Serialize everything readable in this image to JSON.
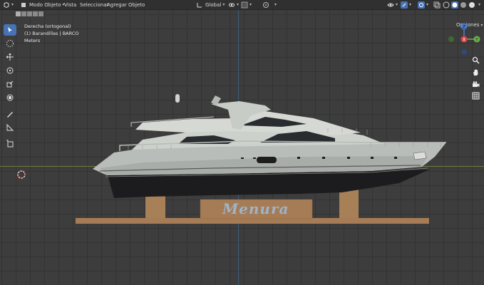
{
  "header": {
    "mode_label": "Modo Objeto",
    "menu": [
      "Vista",
      "Seleccionar",
      "Agregar",
      "Objeto"
    ],
    "transform_orientation": "Global"
  },
  "viewport": {
    "view_name": "Derecha (ortogonal)",
    "collection_info": "(1) Barandillas | BARCO",
    "units": "Meters",
    "options_label": "Opciones",
    "hull_name_text": "Menura"
  },
  "gizmo": {
    "z_label": "Z",
    "y_label": "Y",
    "x_label": "X"
  },
  "colors": {
    "accent": "#4772b3",
    "x_axis": "#e0414c",
    "y_axis": "#6ab04c",
    "z_axis": "#4a7cd0"
  },
  "icons": [
    "cursor-icon",
    "select-box-icon",
    "move-icon",
    "rotate-icon",
    "scale-icon",
    "transform-icon",
    "annotate-icon",
    "measure-icon",
    "add-cube-icon",
    "zoom-icon",
    "hand-icon",
    "camera-icon",
    "grid-icon"
  ]
}
